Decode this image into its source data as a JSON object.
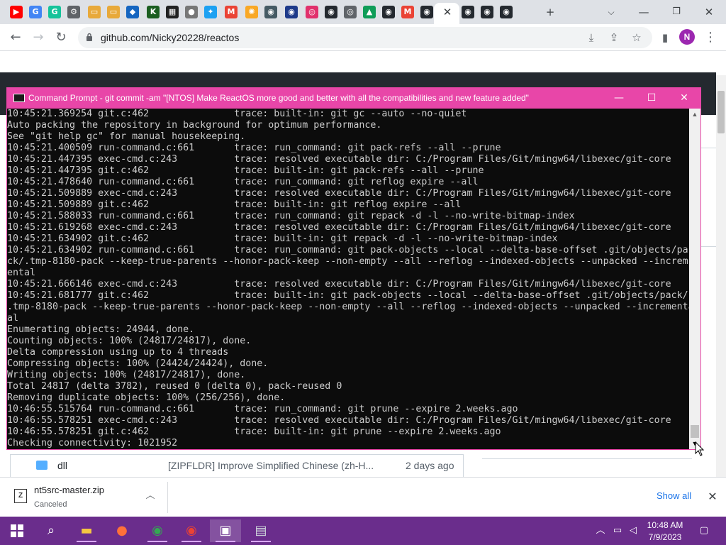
{
  "browser": {
    "tabs": [
      {
        "name": "youtube-tab-icon",
        "glyph": "▶",
        "color": "#ff0000"
      },
      {
        "name": "google-tab-icon",
        "glyph": "G",
        "color": "#4285f4"
      },
      {
        "name": "grammarly-tab-icon",
        "glyph": "G",
        "color": "#15c39a"
      },
      {
        "name": "settings-tab-icon",
        "glyph": "⚙",
        "color": "#5f6368"
      },
      {
        "name": "folder-tab-icon",
        "glyph": "▭",
        "color": "#e8a93a"
      },
      {
        "name": "folder-tab-icon-2",
        "glyph": "▭",
        "color": "#e8a93a"
      },
      {
        "name": "app-tab-icon",
        "glyph": "◆",
        "color": "#1565c0"
      },
      {
        "name": "km-tab-icon",
        "glyph": "K",
        "color": "#1b5e20"
      },
      {
        "name": "qr-tab-icon",
        "glyph": "▦",
        "color": "#222222"
      },
      {
        "name": "circle-tab-icon",
        "glyph": "●",
        "color": "#777777"
      },
      {
        "name": "twitter-tab-icon",
        "glyph": "✦",
        "color": "#1da1f2"
      },
      {
        "name": "gmail-tab-icon",
        "glyph": "M",
        "color": "#ea4335"
      },
      {
        "name": "bulb-tab-icon",
        "glyph": "✺",
        "color": "#f9a825"
      },
      {
        "name": "avatar-tab-icon",
        "glyph": "◉",
        "color": "#455a64"
      },
      {
        "name": "sonic-tab-icon",
        "glyph": "◉",
        "color": "#1e3a8a"
      },
      {
        "name": "instagram-tab-icon",
        "glyph": "◎",
        "color": "#e1306c"
      },
      {
        "name": "github-tab-icon",
        "glyph": "◉",
        "color": "#24292f"
      },
      {
        "name": "chrome-tab-icon",
        "glyph": "◎",
        "color": "#5f6368"
      },
      {
        "name": "drive-tab-icon",
        "glyph": "▲",
        "color": "#0f9d58"
      },
      {
        "name": "github-tab-icon-2",
        "glyph": "◉",
        "color": "#24292f"
      },
      {
        "name": "gmail-tab-icon-2",
        "glyph": "M",
        "color": "#ea4335"
      },
      {
        "name": "github-tab-icon-3",
        "glyph": "◉",
        "color": "#24292f"
      },
      {
        "name": "github-tab-icon-4",
        "glyph": "◉",
        "color": "#24292f"
      },
      {
        "name": "github-tab-icon-5",
        "glyph": "◉",
        "color": "#24292f"
      },
      {
        "name": "github-tab-icon-6",
        "glyph": "◉",
        "color": "#24292f"
      }
    ],
    "url": "github.com/Nicky20228/reactos",
    "profile_initial": "N"
  },
  "github": {
    "file_row": {
      "name": "dll",
      "message": "[ZIPFLDR] Improve Simplified Chinese (zh-H...",
      "age": "2 days ago"
    }
  },
  "cmd": {
    "title": "Command Prompt - git  commit -am \"[NTOS] Make ReactOS more good and better with all the compatibilities and new feature added\"",
    "lines": [
      "10:45:21.369254 git.c:462               trace: built-in: git gc --auto --no-quiet",
      "Auto packing the repository in background for optimum performance.",
      "See \"git help gc\" for manual housekeeping.",
      "10:45:21.400509 run-command.c:661       trace: run_command: git pack-refs --all --prune",
      "10:45:21.447395 exec-cmd.c:243          trace: resolved executable dir: C:/Program Files/Git/mingw64/libexec/git-core",
      "10:45:21.447395 git.c:462               trace: built-in: git pack-refs --all --prune",
      "10:45:21.478640 run-command.c:661       trace: run_command: git reflog expire --all",
      "10:45:21.509889 exec-cmd.c:243          trace: resolved executable dir: C:/Program Files/Git/mingw64/libexec/git-core",
      "10:45:21.509889 git.c:462               trace: built-in: git reflog expire --all",
      "10:45:21.588033 run-command.c:661       trace: run_command: git repack -d -l --no-write-bitmap-index",
      "10:45:21.619268 exec-cmd.c:243          trace: resolved executable dir: C:/Program Files/Git/mingw64/libexec/git-core",
      "10:45:21.634902 git.c:462               trace: built-in: git repack -d -l --no-write-bitmap-index",
      "10:45:21.634902 run-command.c:661       trace: run_command: git pack-objects --local --delta-base-offset .git/objects/pa",
      "ck/.tmp-8180-pack --keep-true-parents --honor-pack-keep --non-empty --all --reflog --indexed-objects --unpacked --increm",
      "ental",
      "10:45:21.666146 exec-cmd.c:243          trace: resolved executable dir: C:/Program Files/Git/mingw64/libexec/git-core",
      "10:45:21.681777 git.c:462               trace: built-in: git pack-objects --local --delta-base-offset .git/objects/pack/",
      ".tmp-8180-pack --keep-true-parents --honor-pack-keep --non-empty --all --reflog --indexed-objects --unpacked --incremental",
      "al",
      "Enumerating objects: 24944, done.",
      "Counting objects: 100% (24817/24817), done.",
      "Delta compression using up to 4 threads",
      "Compressing objects: 100% (24424/24424), done.",
      "Writing objects: 100% (24817/24817), done.",
      "Total 24817 (delta 3782), reused 0 (delta 0), pack-reused 0",
      "Removing duplicate objects: 100% (256/256), done.",
      "10:46:55.515764 run-command.c:661       trace: run_command: git prune --expire 2.weeks.ago",
      "10:46:55.578251 exec-cmd.c:243          trace: resolved executable dir: C:/Program Files/Git/mingw64/libexec/git-core",
      "10:46:55.578251 git.c:462               trace: built-in: git prune --expire 2.weeks.ago",
      "Checking connectivity: 1021952"
    ]
  },
  "downloads": {
    "file_name": "nt5src-master.zip",
    "status": "Canceled",
    "show_all": "Show all"
  },
  "taskbar": {
    "time": "10:48 AM",
    "date": "7/9/2023"
  }
}
